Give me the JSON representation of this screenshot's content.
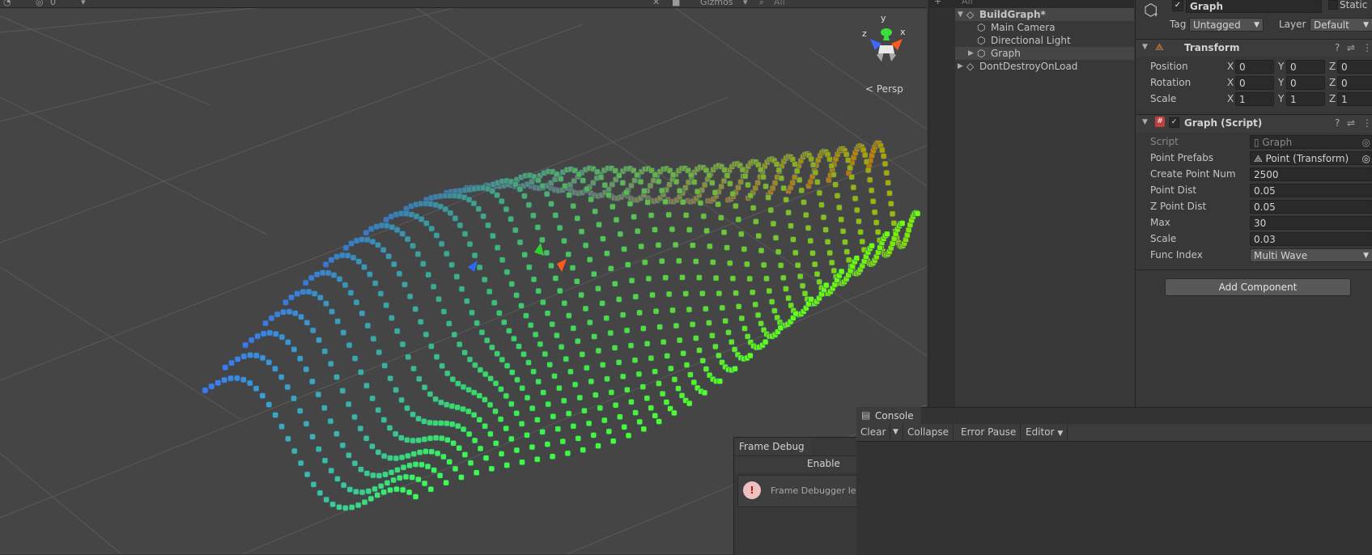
{
  "scene": {
    "gizmos_label": "Gizmos",
    "search_placeholder": "All",
    "counter_label": "0",
    "persp_label": "Persp",
    "axis_labels": {
      "x": "x",
      "y": "y",
      "z": "z"
    }
  },
  "hierarchy": {
    "search_placeholder": "All",
    "items": [
      {
        "label": "BuildGraph*",
        "icon": "unity-scene-icon"
      },
      {
        "label": "Main Camera",
        "icon": "gameobject-cube-icon"
      },
      {
        "label": "Directional Light",
        "icon": "gameobject-cube-icon"
      },
      {
        "label": "Graph",
        "icon": "gameobject-cube-icon"
      },
      {
        "label": "DontDestroyOnLoad",
        "icon": "unity-scene-icon"
      }
    ]
  },
  "inspector": {
    "object_name": "Graph",
    "static_label": "Static",
    "tag_label": "Tag",
    "tag_value": "Untagged",
    "layer_label": "Layer",
    "layer_value": "Default",
    "transform": {
      "title": "Transform",
      "rows": [
        {
          "label": "Position",
          "x": "0",
          "y": "0",
          "z": "0"
        },
        {
          "label": "Rotation",
          "x": "0",
          "y": "0",
          "z": "0"
        },
        {
          "label": "Scale",
          "x": "1",
          "y": "1",
          "z": "1"
        }
      ],
      "axis_x": "X",
      "axis_y": "Y",
      "axis_z": "Z"
    },
    "graph_script": {
      "title": "Graph (Script)",
      "fields": [
        {
          "label": "Script",
          "value": "Graph"
        },
        {
          "label": "Point Prefabs",
          "value": "Point (Transform)"
        },
        {
          "label": "Create Point Num",
          "value": "2500"
        },
        {
          "label": "Point Dist",
          "value": "0.05"
        },
        {
          "label": "Z Point Dist",
          "value": "0.05"
        },
        {
          "label": "Max",
          "value": "30"
        },
        {
          "label": "Scale",
          "value": "0.03"
        },
        {
          "label": "Func Index",
          "value": "Multi Wave"
        }
      ]
    },
    "add_component_label": "Add Component"
  },
  "console": {
    "tab_label": "Console",
    "toolbar": {
      "clear": "Clear",
      "collapse": "Collapse",
      "error_pause": "Error Pause",
      "editor": "Editor"
    }
  },
  "frame_debugger": {
    "tab_label": "Frame Debug",
    "enable_label": "Enable",
    "info_text": "Frame Debugger lets yo"
  }
}
